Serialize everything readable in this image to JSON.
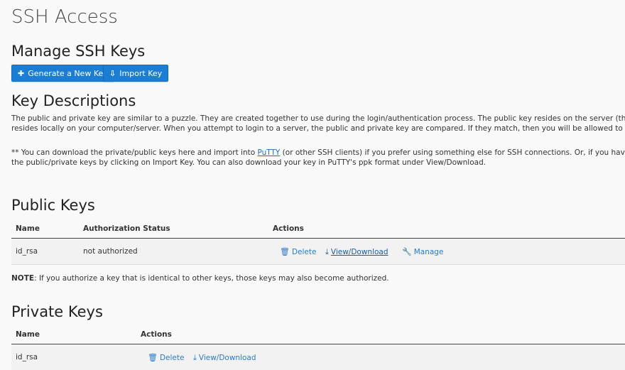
{
  "page": {
    "title": "SSH Access"
  },
  "manage": {
    "heading": "Manage SSH Keys",
    "generate_label": "Generate a New Key",
    "import_label": "Import Key"
  },
  "descriptions": {
    "heading": "Key Descriptions",
    "line1": "The public and private key are similar to a puzzle. They are created together to use during the login/authentication process. The public key resides on the server (the remote location). The",
    "line2": "resides locally on your computer/server. When you attempt to login to a server, the public and private key are compared. If they match, then you will be allowed to login to the server loca",
    "line3_pre": "** You can download the private/public keys here and import into ",
    "line3_link": "PuTTY",
    "line3_post": " (or other SSH clients) if you prefer using something else for SSH connections. Or, if you have been using PuTTY, y",
    "line4": "the public/private keys by clicking on Import Key. You can also download your key in PuTTY's ppk format under View/Download."
  },
  "public_keys": {
    "heading": "Public Keys",
    "col_name": "Name",
    "col_status": "Authorization Status",
    "col_actions": "Actions",
    "rows": [
      {
        "name": "id_rsa",
        "status": "not authorized",
        "delete": "Delete",
        "view": "View/Download",
        "manage": "Manage"
      }
    ]
  },
  "note": {
    "label": "NOTE",
    "text": ": If you authorize a key that is identical to other keys, those keys may also become authorized."
  },
  "private_keys": {
    "heading": "Private Keys",
    "col_name": "Name",
    "col_actions": "Actions",
    "rows": [
      {
        "name": "id_rsa",
        "delete": "Delete",
        "view": "View/Download"
      }
    ]
  },
  "colors": {
    "button": "#1b7ed4",
    "link": "#2a7bc9"
  },
  "icons": {
    "generate": "plus-icon",
    "import": "import-icon",
    "delete": "trash-icon",
    "download": "download-icon",
    "manage": "wrench-icon"
  }
}
